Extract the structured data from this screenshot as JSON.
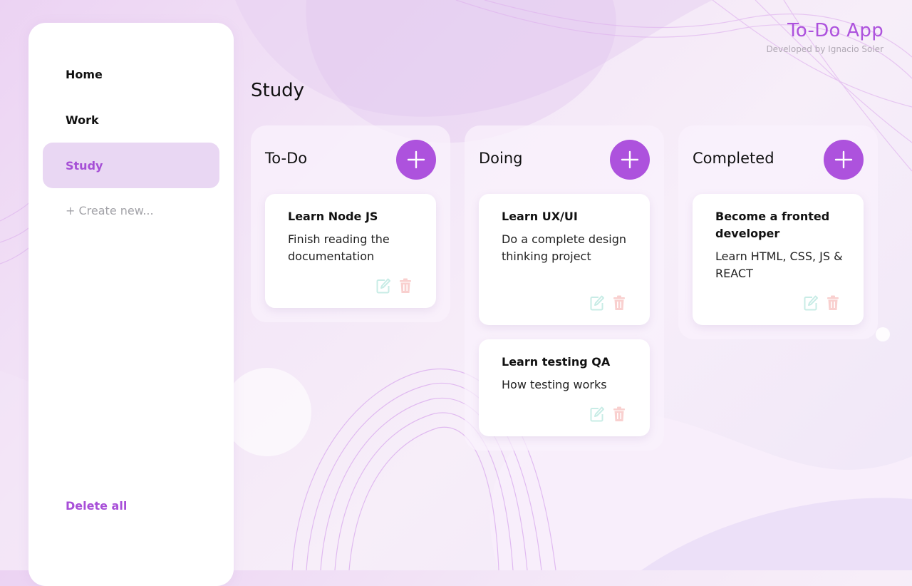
{
  "app": {
    "title": "To-Do App",
    "subtitle": "Developed by Ignacio Soler",
    "accent_color": "#ad52dd"
  },
  "sidebar": {
    "items": [
      {
        "label": "Home",
        "active": false
      },
      {
        "label": "Work",
        "active": false
      },
      {
        "label": "Study",
        "active": true
      }
    ],
    "create_new_label": "+ Create new...",
    "delete_all_label": "Delete all"
  },
  "page": {
    "title": "Study"
  },
  "columns": [
    {
      "title": "To-Do",
      "add_icon": "plus-icon",
      "cards": [
        {
          "title": "Learn Node JS",
          "description": "Finish reading the documentation"
        }
      ]
    },
    {
      "title": "Doing",
      "add_icon": "plus-icon",
      "cards": [
        {
          "title": "Learn UX/UI",
          "description": "Do a complete design thinking project"
        },
        {
          "title": "Learn testing QA",
          "description": "How testing works"
        }
      ]
    },
    {
      "title": "Completed",
      "add_icon": "plus-icon",
      "cards": [
        {
          "title": "Become a fronted developer",
          "description": "Learn HTML, CSS, JS & REACT"
        }
      ]
    }
  ],
  "card_actions": {
    "edit_icon": "edit-icon",
    "delete_icon": "trash-icon",
    "edit_color": "#c8ece6",
    "delete_color": "#f9d0cf"
  }
}
